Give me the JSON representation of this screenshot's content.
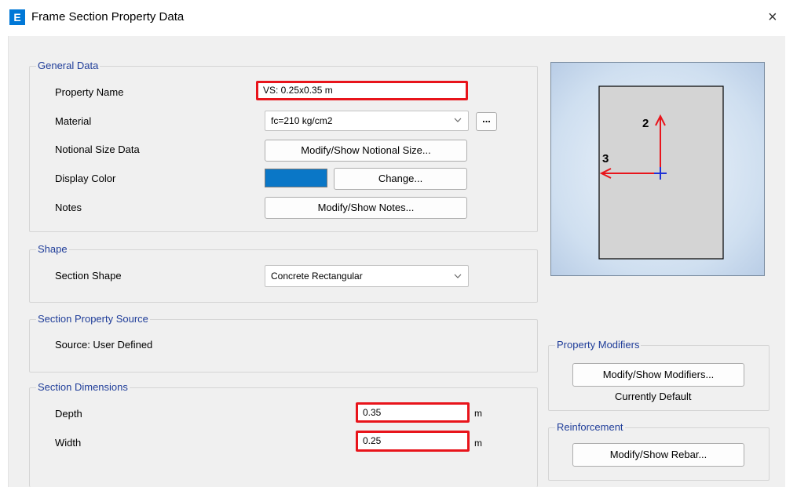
{
  "window": {
    "title": "Frame Section Property Data",
    "app_icon": "E",
    "close_glyph": "×"
  },
  "general_data": {
    "legend": "General Data",
    "property_name_label": "Property Name",
    "property_name_value": "VS: 0.25x0.35 m",
    "material_label": "Material",
    "material_value": "fc=210 kg/cm2",
    "material_more_button": "...",
    "notional_size_label": "Notional Size Data",
    "notional_size_button": "Modify/Show Notional Size...",
    "display_color_label": "Display Color",
    "display_color_value": "#0a77c7",
    "change_button": "Change...",
    "notes_label": "Notes",
    "notes_button": "Modify/Show Notes..."
  },
  "shape": {
    "legend": "Shape",
    "section_shape_label": "Section Shape",
    "section_shape_value": "Concrete Rectangular"
  },
  "source": {
    "legend": "Section Property Source",
    "source_text": "Source:  User Defined"
  },
  "dimensions": {
    "legend": "Section Dimensions",
    "depth_label": "Depth",
    "depth_value": "0.35",
    "depth_unit": "m",
    "width_label": "Width",
    "width_value": "0.25",
    "width_unit": "m"
  },
  "preview": {
    "axis_2_label": "2",
    "axis_3_label": "3"
  },
  "property_modifiers": {
    "legend": "Property Modifiers",
    "button": "Modify/Show Modifiers...",
    "status": "Currently Default"
  },
  "reinforcement": {
    "legend": "Reinforcement",
    "button": "Modify/Show Rebar..."
  },
  "colors": {
    "highlight_red": "#e8141b",
    "legend_blue": "#1f3d99",
    "axis_red": "#e8141b",
    "axis_blue": "#1f32d6"
  }
}
